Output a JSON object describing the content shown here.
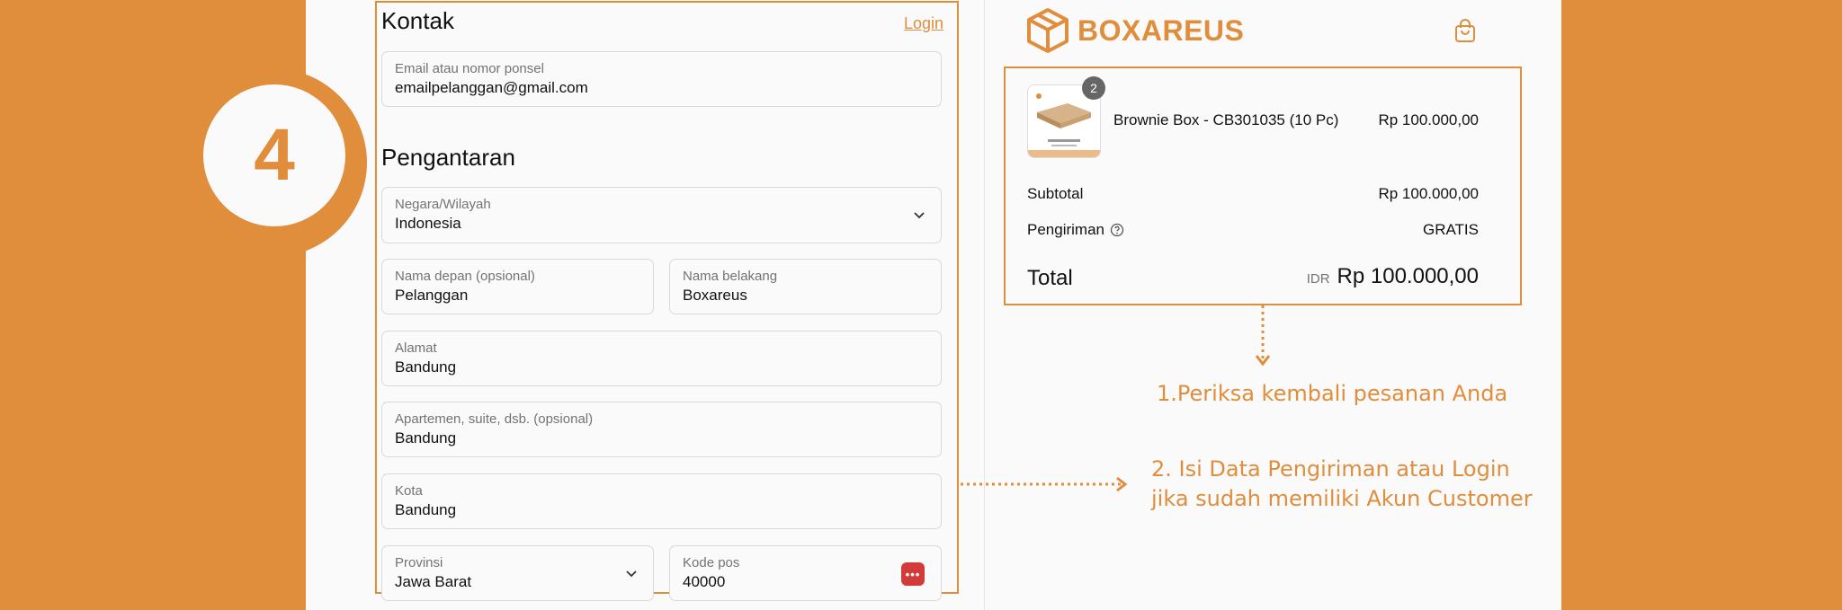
{
  "step": {
    "number": "4"
  },
  "contact": {
    "heading": "Kontak",
    "login_label": "Login",
    "email": {
      "label": "Email atau nomor ponsel",
      "value": "emailpelanggan@gmail.com"
    }
  },
  "shipping": {
    "heading": "Pengantaran",
    "country": {
      "label": "Negara/Wilayah",
      "value": "Indonesia"
    },
    "first_name": {
      "label": "Nama depan (opsional)",
      "value": "Pelanggan"
    },
    "last_name": {
      "label": "Nama belakang",
      "value": "Boxareus"
    },
    "address": {
      "label": "Alamat",
      "value": "Bandung"
    },
    "apartment": {
      "label": "Apartemen, suite, dsb. (opsional)",
      "value": "Bandung"
    },
    "city": {
      "label": "Kota",
      "value": "Bandung"
    },
    "province": {
      "label": "Provinsi",
      "value": "Jawa Barat"
    },
    "postal_code": {
      "label": "Kode pos",
      "value": "40000"
    }
  },
  "brand": {
    "name": "BOXAREUS",
    "color": "#e08d3c"
  },
  "summary": {
    "item": {
      "quantity": "2",
      "name": "Brownie Box - CB301035 (10 Pc)",
      "price": "Rp 100.000,00"
    },
    "subtotal_label": "Subtotal",
    "subtotal_value": "Rp 100.000,00",
    "shipping_label": "Pengiriman",
    "shipping_value": "GRATIS",
    "total_label": "Total",
    "total_currency": "IDR",
    "total_value": "Rp 100.000,00"
  },
  "annotations": {
    "step1": "1.Periksa kembali pesanan Anda",
    "step2_line1": "2. Isi Data Pengiriman atau Login",
    "step2_line2": "jika sudah memiliki Akun Customer"
  },
  "icons": {
    "chevron": "chevron-down-icon",
    "bag": "shopping-bag-icon",
    "help": "help-circle-icon",
    "password_manager": "password-manager-icon"
  }
}
